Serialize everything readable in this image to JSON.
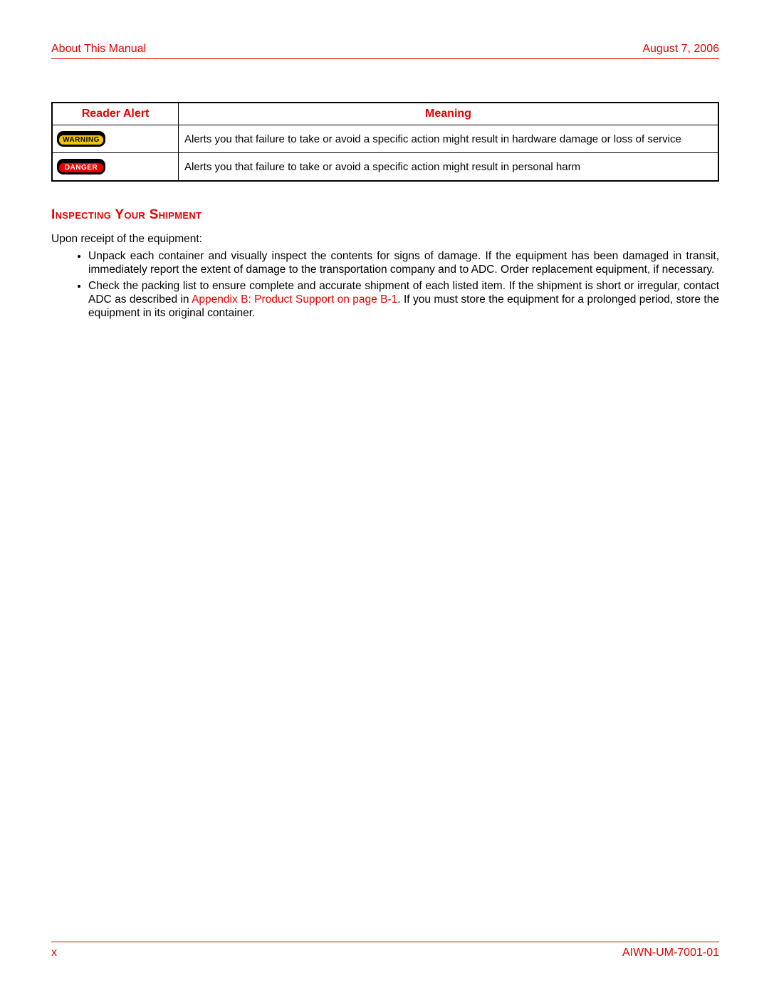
{
  "header": {
    "left": "About This Manual",
    "right": "August 7, 2006"
  },
  "table": {
    "header_alert": "Reader Alert",
    "header_meaning": "Meaning",
    "rows": [
      {
        "badge_label": "WARNING",
        "badge_type": "warning",
        "meaning": "Alerts you that failure to take or avoid a specific action might result in hardware damage or loss of service"
      },
      {
        "badge_label": "DANGER",
        "badge_type": "danger",
        "meaning": "Alerts you that failure to take or avoid a specific action might result in personal harm"
      }
    ]
  },
  "section": {
    "heading": "Inspecting Your Shipment",
    "intro": "Upon receipt of the equipment:",
    "bullets": [
      {
        "pre": "Unpack each container and visually inspect the contents for signs of damage. If the equipment has been damaged in transit, immediately report the extent of damage to the transportation company and to ADC. Order replacement equipment, if necessary.",
        "link": "",
        "post": ""
      },
      {
        "pre": "Check the packing list to ensure complete and accurate shipment of each listed item. If the shipment is short or irregular, contact ADC as described in ",
        "link": "Appendix B: Product Support on page B-1",
        "post": ". If you must store the equipment for a prolonged period, store the equipment in its original container."
      }
    ]
  },
  "footer": {
    "left": "x",
    "right": "AIWN-UM-7001-01"
  }
}
